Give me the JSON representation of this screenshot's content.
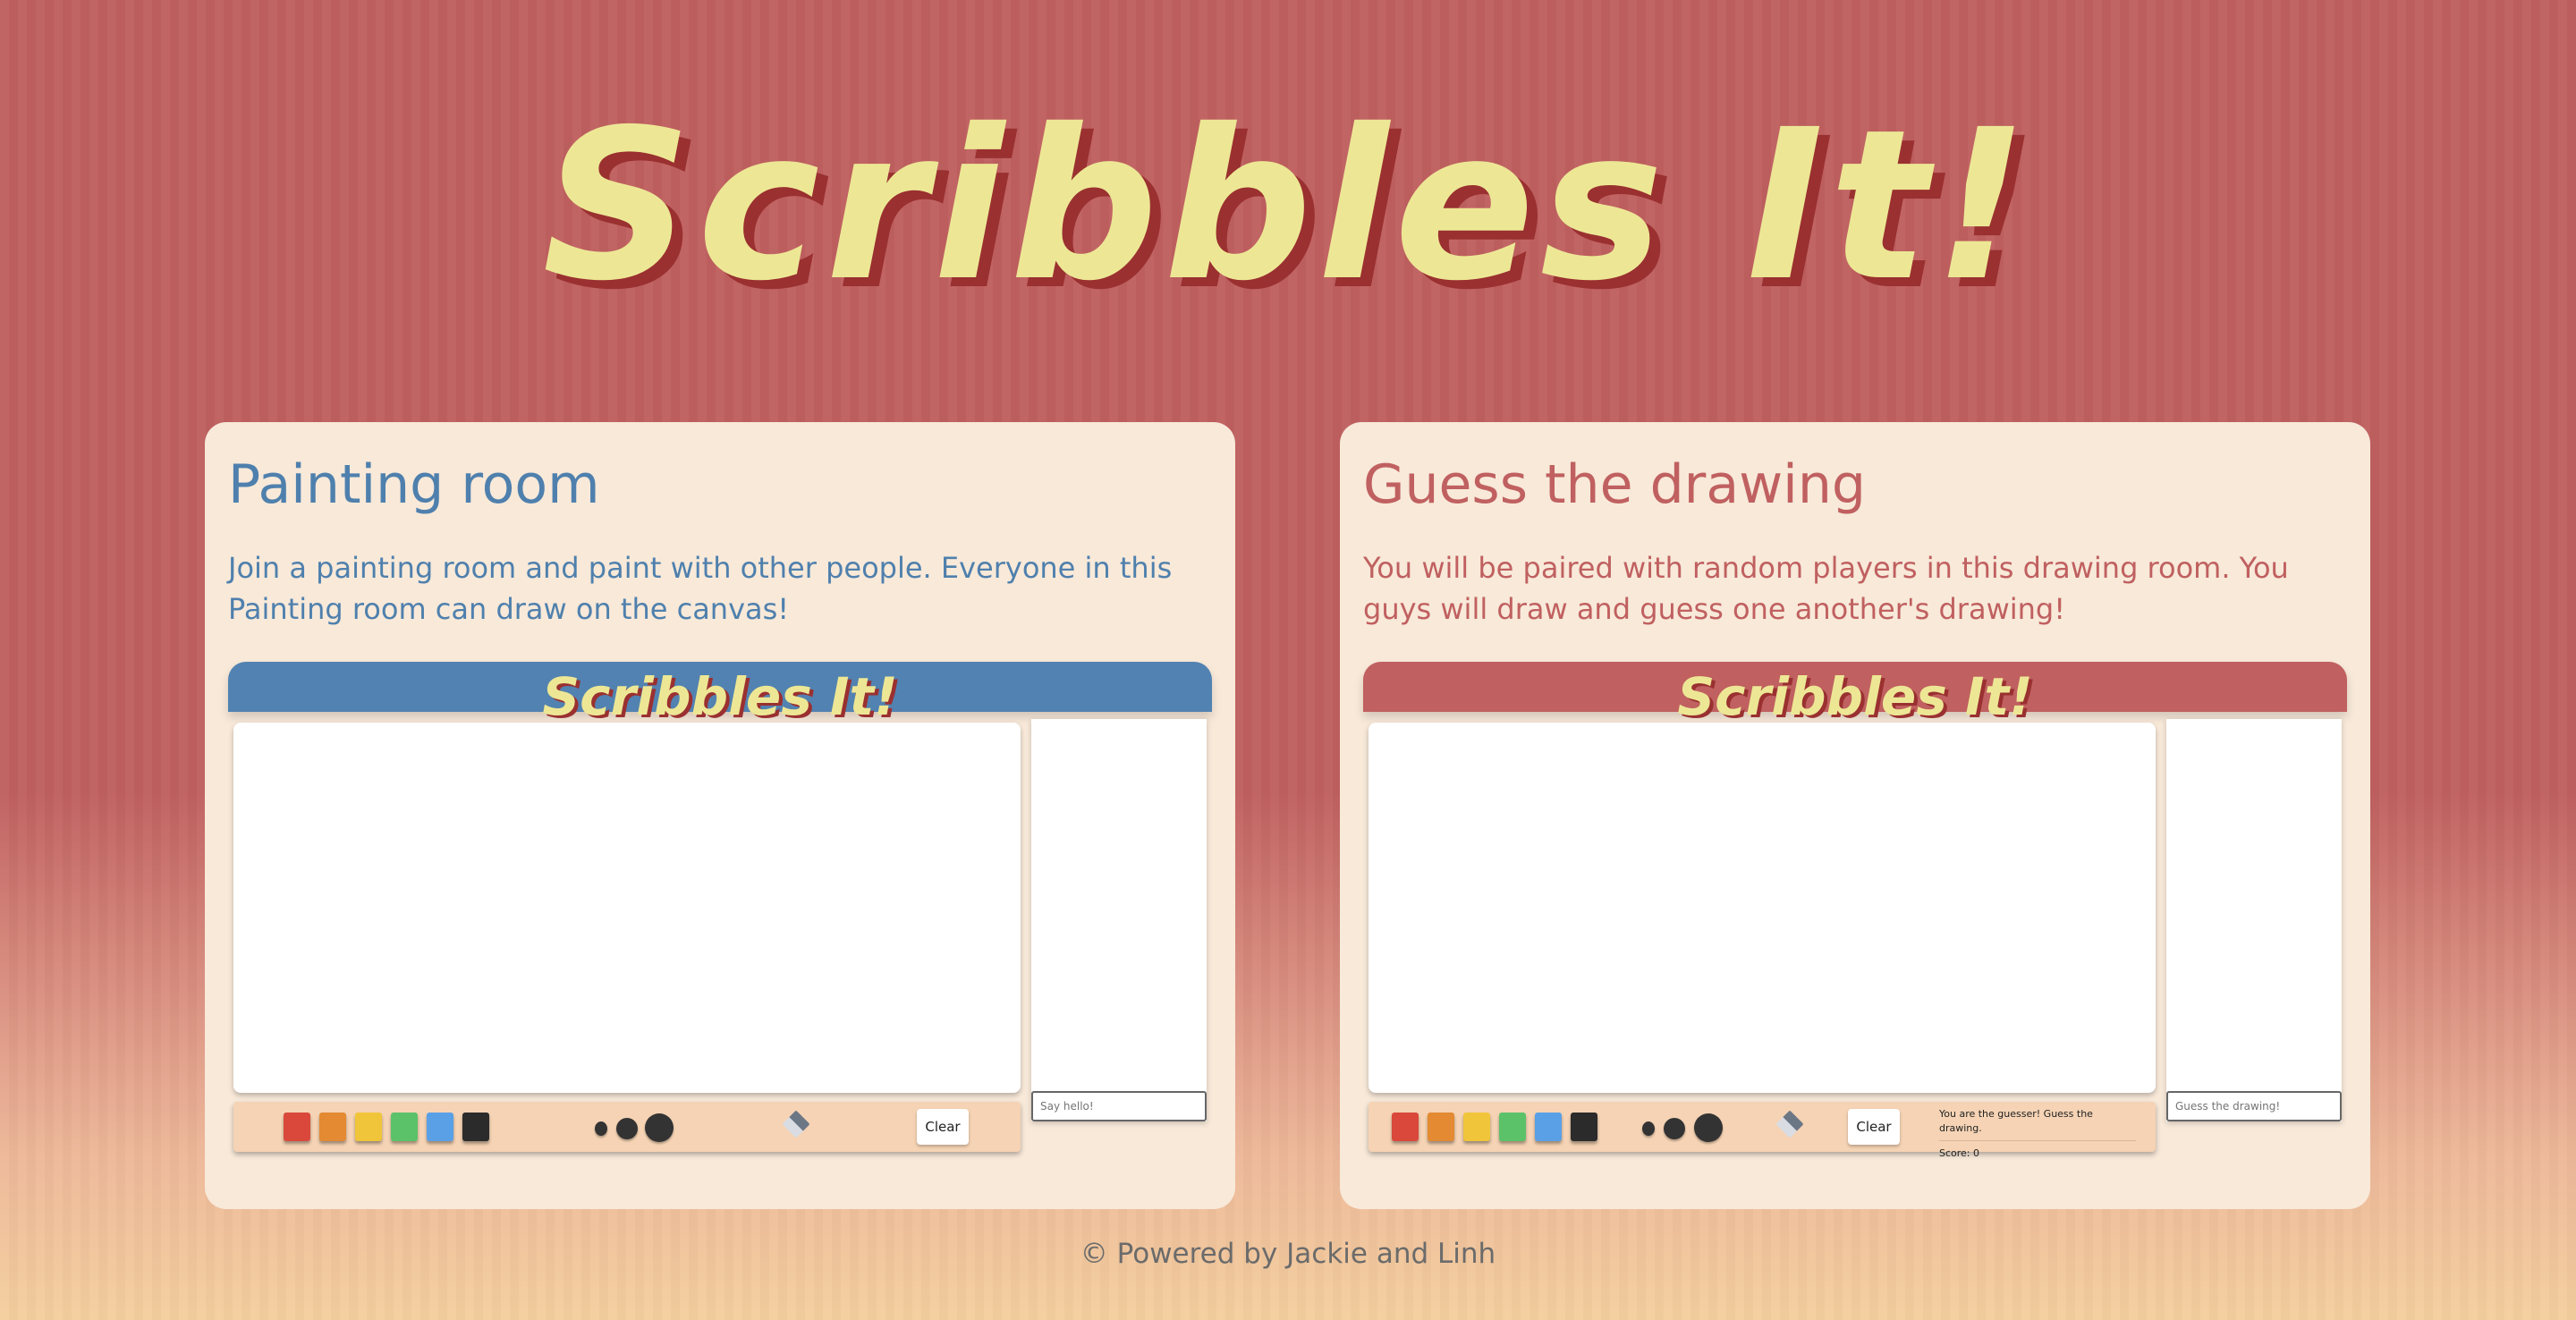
{
  "hero": {
    "title": "Scribbles It!"
  },
  "cards": {
    "painting": {
      "title": "Painting room",
      "description": "Join a painting room and paint with other people. Everyone in this Painting room can draw on the canvas!",
      "preview_title": "Scribbles It!",
      "clear_label": "Clear",
      "chat_placeholder": "Say hello!"
    },
    "guess": {
      "title": "Guess the drawing",
      "description": "You will be paired with random players in this drawing room. You guys will draw and guess one another's drawing!",
      "preview_title": "Scribbles It!",
      "clear_label": "Clear",
      "status_text": "You are the guesser! Guess the drawing.",
      "score_text": "Score: 0",
      "chat_placeholder": "Guess the drawing!"
    }
  },
  "palette": {
    "colors": [
      "#d9483b",
      "#e38a32",
      "#f0c53a",
      "#5cc26a",
      "#5aa0e6",
      "#2b2b2b"
    ],
    "brush_sizes": [
      "small",
      "medium",
      "large"
    ]
  },
  "colors": {
    "background": "#c06060",
    "card": "#f8e9d9",
    "blue_accent": "#5282b1",
    "red_accent": "#c06060",
    "title_yellow": "#ede795"
  },
  "footer": {
    "text": "© Powered by Jackie and Linh"
  }
}
